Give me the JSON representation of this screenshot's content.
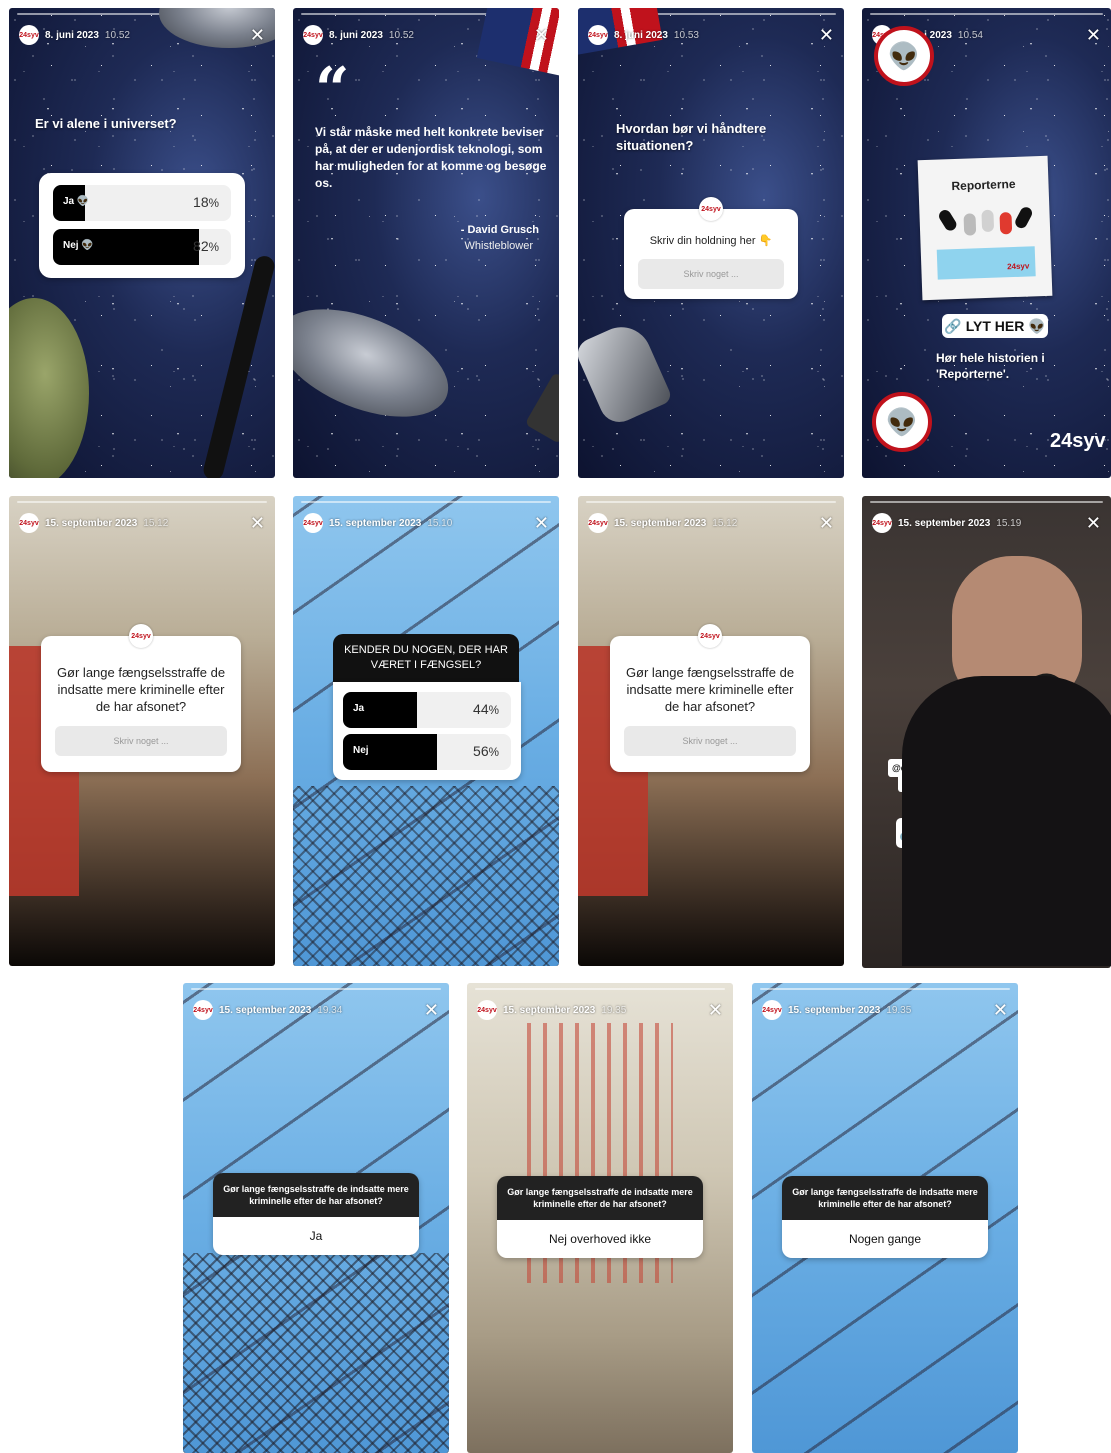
{
  "brand": {
    "logo_text": "24syv",
    "accent": "#c0121c"
  },
  "close_glyph": "✕",
  "stories": {
    "s1": {
      "date": "8. juni 2023",
      "time": "10.52",
      "question": "Er vi alene i universet?",
      "options": [
        {
          "label": "Ja 👽",
          "pct": 18,
          "pct_text": "18",
          "unit": "%"
        },
        {
          "label": "Nej 👽",
          "pct": 82,
          "pct_text": "82",
          "unit": "%"
        }
      ]
    },
    "s2": {
      "date": "8. juni 2023",
      "time": "10.52",
      "quote_mark": "“",
      "quote": "Vi står måske med helt konkrete beviser på, at der er udenjordisk teknologi, som har muligheden for at komme og besøge os.",
      "author": "- David Grusch",
      "role": "Whistleblower"
    },
    "s3": {
      "date": "8. juni 2023",
      "time": "10.53",
      "question": "Hvordan bør vi håndtere situationen?",
      "box_text": "Skriv din holdning her 👇",
      "placeholder": "Skriv noget ..."
    },
    "s4": {
      "date": "8. juni 2023",
      "time": "10.54",
      "note_title": "Reporterne",
      "note_logo": "24syv",
      "link": "LYT HER 👽",
      "text": "Hør hele historien i 'Reporterne'.",
      "brand": "24syv"
    },
    "s5": {
      "date": "15. september 2023",
      "time": "15.12",
      "box_text": "Gør lange fængselsstraffe de indsatte mere kriminelle efter de har afsonet?",
      "placeholder": "Skriv noget ..."
    },
    "s6": {
      "date": "15. september 2023",
      "time": "15.10",
      "question": "KENDER DU NOGEN, DER HAR VÆRET I FÆNGSEL?",
      "options": [
        {
          "label": "Ja",
          "pct": 44,
          "pct_text": "44",
          "unit": "%"
        },
        {
          "label": "Nej",
          "pct": 56,
          "pct_text": "56",
          "unit": "%"
        }
      ]
    },
    "s7": {
      "date": "15. september 2023",
      "time": "15.12",
      "box_text": "Gør lange fængselsstraffe de indsatte mere kriminelle efter de har afsonet?",
      "placeholder": "Skriv noget ..."
    },
    "s8": {
      "date": "15. september 2023",
      "time": "15.19",
      "caption_l1": "Den tidligere rockerpræsident",
      "caption_l2": "@celosse_andersen mener, at man bliver",
      "caption_l3": "mere kriminel af at komme i fængsel",
      "link": "LYT TIL 'REPORTERNE'",
      "subtitle_l1": "Men ligesom en",
      "subtitle_l2": "journalisthøjskole"
    },
    "s9": {
      "date": "15. september 2023",
      "time": "19.34",
      "question": "Gør lange fængselsstraffe de indsatte mere kriminelle efter de har afsonet?",
      "answer": "Ja"
    },
    "s10": {
      "date": "15. september 2023",
      "time": "19.35",
      "question": "Gør lange fængselsstraffe de indsatte mere kriminelle efter de har afsonet?",
      "answer": "Nej overhoved ikke"
    },
    "s11": {
      "date": "15. september 2023",
      "time": "19.35",
      "question": "Gør lange fængselsstraffe de indsatte mere kriminelle efter de har afsonet?",
      "answer": "Nogen gange"
    }
  }
}
